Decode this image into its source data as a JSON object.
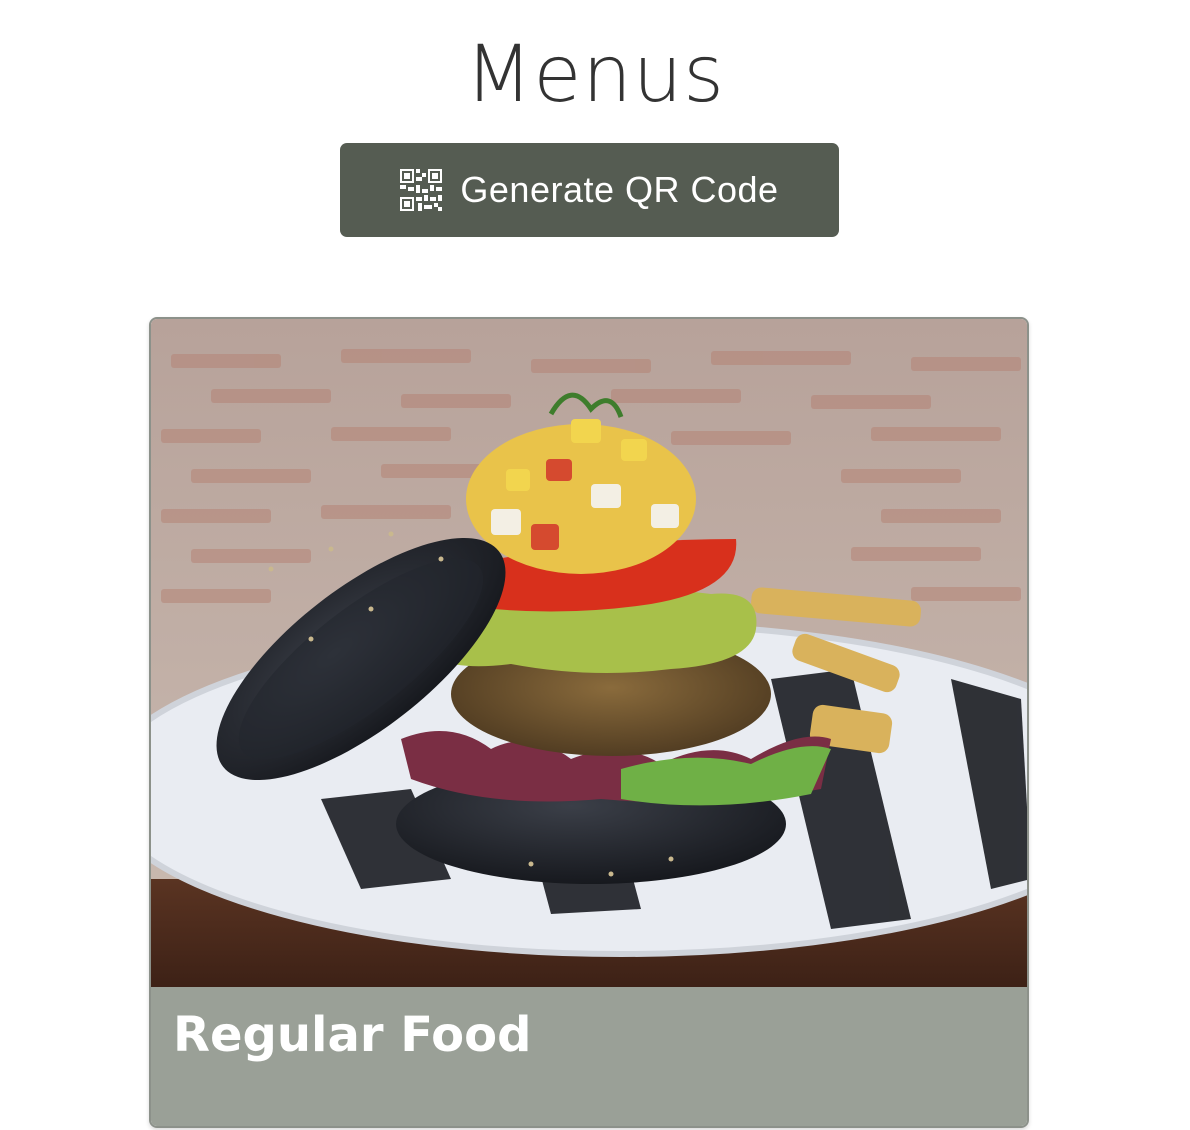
{
  "header": {
    "title": "Menus"
  },
  "actions": {
    "generate_qr_label": "Generate QR Code",
    "generate_qr_icon": "qr-code-icon"
  },
  "menus": [
    {
      "title": "Regular Food",
      "image": "veggie-burger-photo"
    }
  ],
  "colors": {
    "button_bg": "#555c52",
    "card_footer_bg": "#9aa097",
    "title_text": "#333333"
  }
}
